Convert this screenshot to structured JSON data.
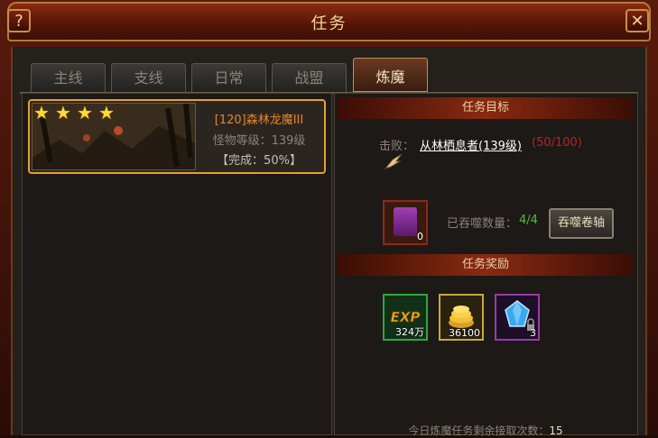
{
  "window": {
    "title": "任务",
    "help_label": "?",
    "close_label": "✕"
  },
  "tabs": [
    {
      "label": "主线"
    },
    {
      "label": "支线"
    },
    {
      "label": "日常"
    },
    {
      "label": "战盟"
    },
    {
      "label": "炼魔",
      "active": true
    }
  ],
  "quest_list": [
    {
      "stars": 4,
      "name": "[120]森林龙魔III",
      "monster_level": "怪物等级：139级",
      "completion": "【完成：50%】"
    }
  ],
  "objective": {
    "header": "任务目标",
    "defeat_label": "击败：",
    "target": "从林栖息者(139级)",
    "count": "(50/100)"
  },
  "devour": {
    "scroll_qty": "0",
    "label": "已吞噬数量：",
    "count": "4/4",
    "button_label": "吞噬卷轴"
  },
  "rewards": {
    "header": "任务奖励",
    "items": [
      {
        "icon": "exp-icon",
        "qty": "324万",
        "border": "#2fa83a"
      },
      {
        "icon": "gold-coins-icon",
        "qty": "36100",
        "border": "#c9a83a"
      },
      {
        "icon": "blue-gem-icon",
        "qty": "3",
        "border": "#9a3aa8"
      }
    ]
  },
  "footer": {
    "label": "今日炼魔任务剩余接取次数：",
    "value": "15"
  }
}
